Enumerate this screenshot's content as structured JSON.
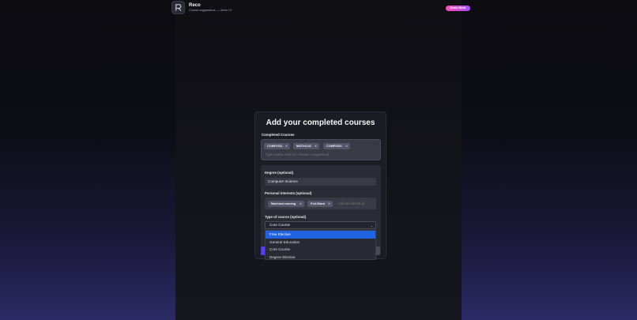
{
  "brand": {
    "name": "Reco",
    "tagline": "Course suggestions — demo UI",
    "badge": "Demo Mode"
  },
  "form": {
    "title": "Add your completed courses",
    "completed_label": "Completed Courses",
    "completed_courses": [
      "COMP1511",
      "MATH1131",
      "COMP2521"
    ],
    "completed_placeholder": "Type course code (or choose a suggestion)",
    "degree_label": "Degree (optional)",
    "degree_value": "Computer Science",
    "interests_label": "Personal interests (optional)",
    "interests": [
      "MachineLearning",
      "Full-Stack"
    ],
    "interests_placeholder": "Add an interest (p",
    "type_label": "Type of course (optional)",
    "type_value": "Core Course",
    "type_options": [
      "Free Elective",
      "General Education",
      "Core Course",
      "Degree Elective"
    ],
    "highlighted_option": "Free Elective"
  },
  "icons": {
    "logo": "r-logo-icon",
    "chip_remove": "close-icon",
    "select_arrow": "chevron-down-icon"
  },
  "colors": {
    "accent_gradient_start": "#ff4db8",
    "accent_gradient_end": "#a64dff",
    "dropdown_highlight": "#1f63e0",
    "primary_button": "#5b3df0"
  }
}
